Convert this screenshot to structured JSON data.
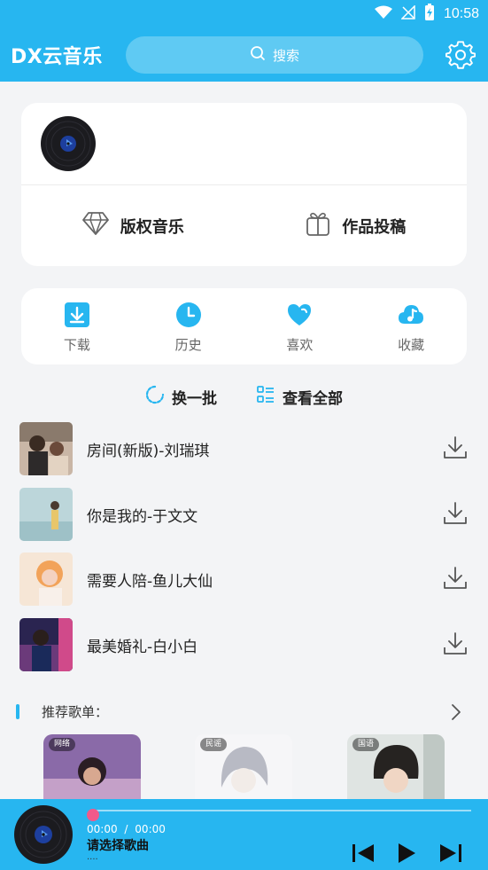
{
  "status_bar": {
    "time": "10:58",
    "icons": [
      "wifi-icon",
      "signal-icon",
      "battery-charging-icon"
    ]
  },
  "app_bar": {
    "title": "DX云音乐",
    "search_placeholder": "搜索",
    "settings_icon": "gear-icon"
  },
  "profile_card": {
    "avatar_icon": "vinyl-disc-icon",
    "actions": [
      {
        "label": "版权音乐",
        "icon": "diamond-icon"
      },
      {
        "label": "作品投稿",
        "icon": "gift-icon"
      }
    ]
  },
  "quick_actions": [
    {
      "label": "下载",
      "icon": "download-icon"
    },
    {
      "label": "历史",
      "icon": "clock-icon"
    },
    {
      "label": "喜欢",
      "icon": "heart-icon"
    },
    {
      "label": "收藏",
      "icon": "cloud-music-icon"
    }
  ],
  "batch": {
    "refresh_label": "换一批",
    "view_all_label": "查看全部"
  },
  "songs": [
    {
      "title": "房间(新版)-刘瑞琪"
    },
    {
      "title": "你是我的-于文文"
    },
    {
      "title": "需要人陪-鱼儿大仙"
    },
    {
      "title": "最美婚礼-白小白"
    }
  ],
  "recommend": {
    "title": "推荐歌单：",
    "playlists": [
      {
        "tag": "网络"
      },
      {
        "tag": "民谣"
      },
      {
        "tag": "国语"
      }
    ]
  },
  "player": {
    "current_time": "00:00",
    "separator": "/",
    "total_time": "00:00",
    "title": "请选择歌曲",
    "subtitle": "....",
    "progress": 0
  },
  "colors": {
    "accent": "#27b6f0",
    "knob": "#f05a8a",
    "background": "#f3f4f6"
  }
}
